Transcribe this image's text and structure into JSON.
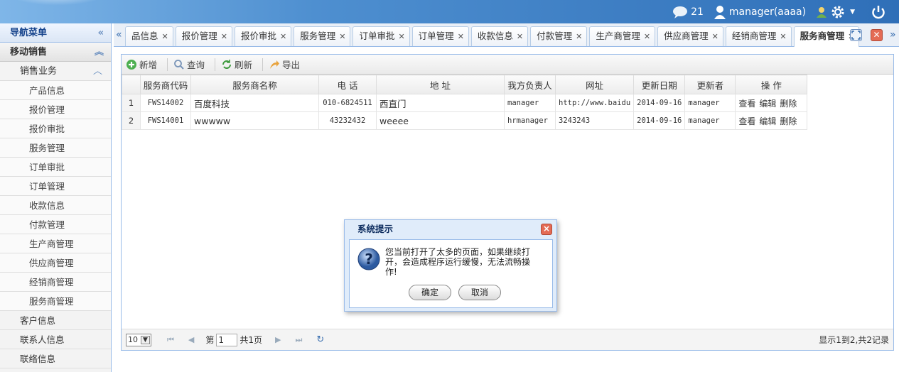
{
  "header": {
    "message_count": "21",
    "user": "manager(aaaa)"
  },
  "nav": {
    "title": "导航菜单",
    "group": "移动销售",
    "sub": "销售业务",
    "leaves": [
      "产品信息",
      "报价管理",
      "报价审批",
      "服务管理",
      "订单审批",
      "订单管理",
      "收款信息",
      "付款管理",
      "生产商管理",
      "供应商管理",
      "经销商管理",
      "服务商管理"
    ],
    "items": [
      "客户信息",
      "联系人信息",
      "联络信息"
    ]
  },
  "tabs": [
    {
      "label": "品信息"
    },
    {
      "label": "报价管理"
    },
    {
      "label": "报价审批"
    },
    {
      "label": "服务管理"
    },
    {
      "label": "订单审批"
    },
    {
      "label": "订单管理"
    },
    {
      "label": "收款信息"
    },
    {
      "label": "付款管理"
    },
    {
      "label": "生产商管理"
    },
    {
      "label": "供应商管理"
    },
    {
      "label": "经销商管理"
    },
    {
      "label": "服务商管理"
    }
  ],
  "toolbar": {
    "add": "新增",
    "query": "查询",
    "refresh": "刷新",
    "export": "导出"
  },
  "table": {
    "headers": [
      "服务商代码",
      "服务商名称",
      "电 话",
      "地 址",
      "我方负责人",
      "网址",
      "更新日期",
      "更新者",
      "操 作"
    ],
    "rows": [
      {
        "num": "1",
        "code": "FWS14002",
        "name": "百度科技",
        "phone": "010-6824511",
        "addr": "西直门",
        "owner": "manager",
        "url": "http://www.baidu",
        "date": "2014-09-16",
        "updater": "manager"
      },
      {
        "num": "2",
        "code": "FWS14001",
        "name": "wwwww",
        "phone": "43232432",
        "addr": "weeee",
        "owner": "hrmanager",
        "url": "3243243",
        "date": "2014-09-16",
        "updater": "manager"
      }
    ],
    "actions": {
      "view": "查看",
      "edit": "编辑",
      "delete": "删除"
    }
  },
  "pager": {
    "page_size": "10",
    "page_label": "第",
    "page_value": "1",
    "total_pages": "共1页",
    "info": "显示1到2,共2记录"
  },
  "dialog": {
    "title": "系统提示",
    "message": "您当前打开了太多的页面，如果继续打开，会造成程序运行缓慢，无法流畅操作!",
    "ok": "确定",
    "cancel": "取消"
  }
}
